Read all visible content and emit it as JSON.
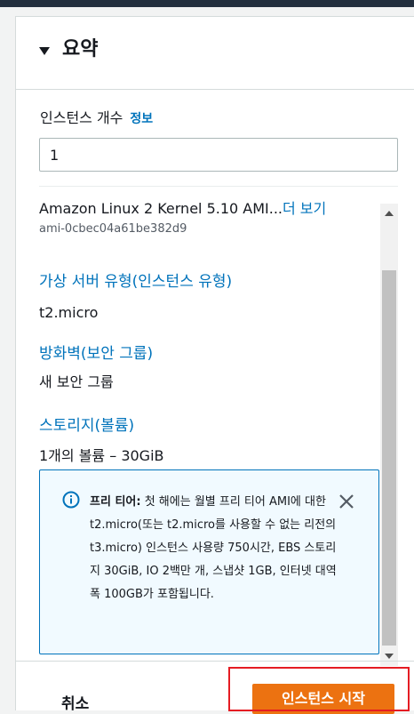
{
  "summary": {
    "title": "요약",
    "instance_count_label": "인스턴스 개수",
    "info_link": "정보",
    "instance_count_value": "1",
    "ami_name": "Amazon Linux 2 Kernel 5.10 AMI...",
    "ami_more_link": "더 보기",
    "ami_id": "ami-0cbec04a61be382d9",
    "instance_type_title": "가상 서버 유형(인스턴스 유형)",
    "instance_type_value": "t2.micro",
    "firewall_title": "방화벽(보안 그룹)",
    "firewall_value": "새 보안 그룹",
    "storage_title": "스토리지(볼륨)",
    "storage_value": "1개의 볼륨 – 30GiB"
  },
  "alert": {
    "bold": "프리 티어:",
    "text": " 첫 해에는 월별 프리 티어 AMI에 대한 t2.micro(또는 t2.micro를 사용할 수 없는 리전의 t3.micro) 인스턴스 사용량 750시간, EBS 스토리지 30GiB, IO 2백만 개, 스냅샷 1GB, 인터넷 대역폭 100GB가 포함됩니다.",
    "icon": "info-icon",
    "close_icon": "close-icon"
  },
  "footer": {
    "cancel_label": "취소",
    "launch_label": "인스턴스 시작"
  },
  "colors": {
    "link": "#0073bb",
    "primary_button": "#ec7211",
    "alert_bg": "#f1faff",
    "highlight": "#e51c23"
  }
}
